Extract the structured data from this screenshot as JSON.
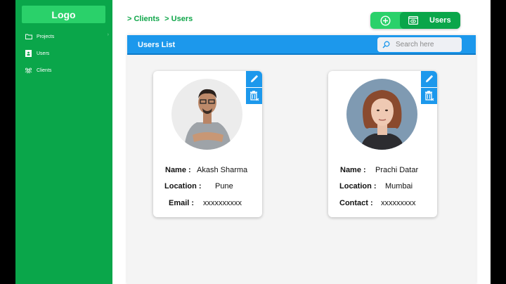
{
  "sidebar": {
    "logo": "Logo",
    "items": [
      {
        "label": "Projects",
        "icon": "folder-icon"
      },
      {
        "label": "Users",
        "icon": "user-icon"
      },
      {
        "label": "Clients",
        "icon": "group-icon"
      }
    ],
    "accent": "#0aa64a"
  },
  "breadcrumb": [
    "> Clients",
    "> Users"
  ],
  "toolbar": {
    "users_label": "Users"
  },
  "panel": {
    "title": "Users List",
    "search_placeholder": "Search here",
    "header_color": "#1c98ec"
  },
  "users": [
    {
      "fields": [
        {
          "key": "Name :",
          "value": "Akash Sharma"
        },
        {
          "key": "Location :",
          "value": "Pune"
        },
        {
          "key": "Email :",
          "value": "xxxxxxxxxx"
        }
      ]
    },
    {
      "fields": [
        {
          "key": "Name :",
          "value": "Prachi Datar"
        },
        {
          "key": "Location :",
          "value": "Mumbai"
        },
        {
          "key": "Contact :",
          "value": "xxxxxxxxx"
        }
      ]
    }
  ]
}
